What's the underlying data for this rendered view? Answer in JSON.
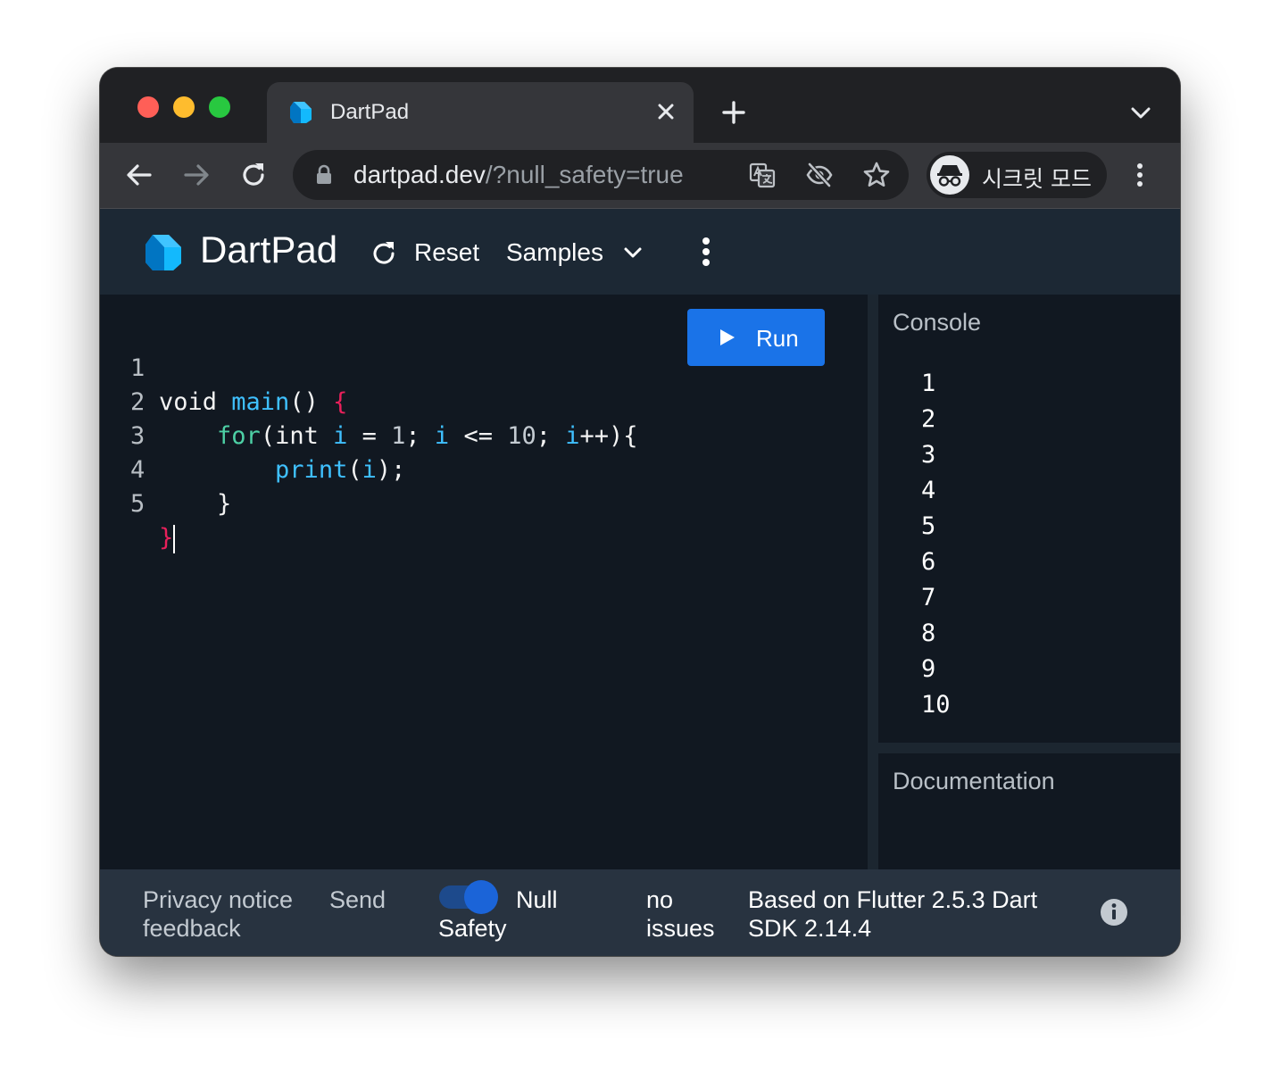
{
  "browser": {
    "tab": {
      "title": "DartPad"
    },
    "omnibox": {
      "host": "dartpad.dev",
      "path": "/?null_safety=true"
    },
    "incognito": {
      "label": "시크릿 모드"
    },
    "icons": [
      "back-icon",
      "forward-icon",
      "reload-icon",
      "lock-icon",
      "translate-icon",
      "tracking-blocked-icon",
      "star-icon",
      "incognito-icon",
      "more-icon"
    ]
  },
  "header": {
    "title": "DartPad",
    "reset_label": "Reset",
    "samples_label": "Samples"
  },
  "editor": {
    "line_numbers": [
      "1",
      "2",
      "3",
      "4",
      "5"
    ],
    "code_lines": [
      "void main() {",
      "    for(int i = 1; i <= 10; i++){",
      "        print(i);",
      "    }",
      "}"
    ],
    "run_label": "Run"
  },
  "console": {
    "title": "Console",
    "output": [
      "1",
      "2",
      "3",
      "4",
      "5",
      "6",
      "7",
      "8",
      "9",
      "10"
    ]
  },
  "documentation": {
    "title": "Documentation"
  },
  "footer": {
    "privacy_line1": "Privacy notice",
    "privacy_line2": "feedback",
    "send": "Send",
    "null_label": "Null",
    "safety_label": "Safety",
    "null_safety_enabled": true,
    "issues_line1": "no",
    "issues_line2": "issues",
    "version_line1": "Based on Flutter 2.5.3 Dart",
    "version_line2": "SDK 2.14.4"
  },
  "colors": {
    "header_bg": "#1c2834",
    "editor_bg": "#111821",
    "footer_bg": "#283340",
    "run_button": "#1a73e8",
    "keyword": "#4dd0a5",
    "identifier": "#3fc0ff",
    "brace": "#e8205b"
  }
}
